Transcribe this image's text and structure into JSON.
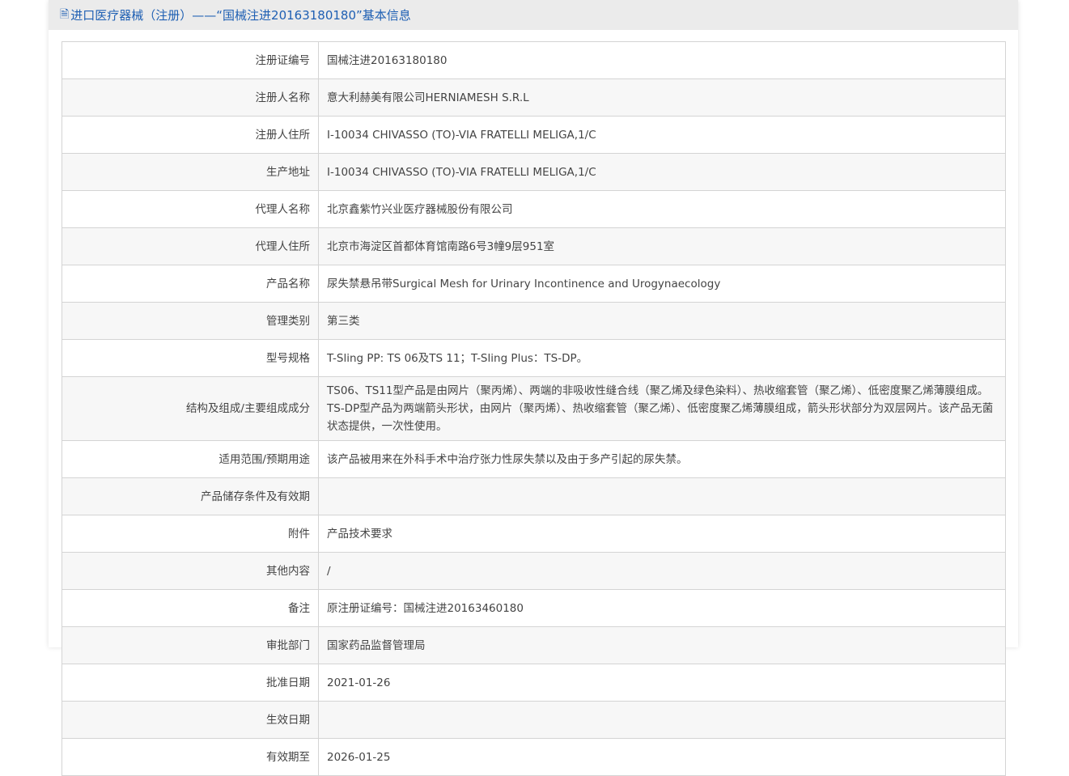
{
  "header": {
    "icon": "document-icon",
    "title": "进口医疗器械（注册）——“国械注进20163180180”基本信息"
  },
  "rows": [
    {
      "label": "注册证编号",
      "value": "国械注进20163180180"
    },
    {
      "label": "注册人名称",
      "value": "意大利赫美有限公司HERNIAMESH S.R.L"
    },
    {
      "label": "注册人住所",
      "value": "I-10034 CHIVASSO (TO)-VIA FRATELLI MELIGA,1/C"
    },
    {
      "label": "生产地址",
      "value": "I-10034 CHIVASSO (TO)-VIA FRATELLI MELIGA,1/C"
    },
    {
      "label": "代理人名称",
      "value": "北京鑫紫竹兴业医疗器械股份有限公司"
    },
    {
      "label": "代理人住所",
      "value": "北京市海淀区首都体育馆南路6号3幢9层951室"
    },
    {
      "label": "产品名称",
      "value": "尿失禁悬吊带Surgical Mesh for Urinary Incontinence and Urogynaecology"
    },
    {
      "label": "管理类别",
      "value": "第三类"
    },
    {
      "label": "型号规格",
      "value": "T-Sling PP: TS 06及TS 11；T-Sling Plus：TS-DP。"
    },
    {
      "label": "结构及组成/主要组成成分",
      "value": "TS06、TS11型产品是由网片（聚丙烯）、两端的非吸收性缝合线（聚乙烯及绿色染料）、热收缩套管（聚乙烯）、低密度聚乙烯薄膜组成。TS-DP型产品为两端箭头形状，由网片（聚丙烯）、热收缩套管（聚乙烯）、低密度聚乙烯薄膜组成，箭头形状部分为双层网片。该产品无菌状态提供，一次性使用。"
    },
    {
      "label": "适用范围/预期用途",
      "value": "该产品被用来在外科手术中治疗张力性尿失禁以及由于多产引起的尿失禁。"
    },
    {
      "label": "产品储存条件及有效期",
      "value": ""
    },
    {
      "label": "附件",
      "value": "产品技术要求"
    },
    {
      "label": "其他内容",
      "value": "/"
    },
    {
      "label": "备注",
      "value": "原注册证编号：国械注进20163460180"
    },
    {
      "label": "审批部门",
      "value": "国家药品监督管理局"
    },
    {
      "label": "批准日期",
      "value": "2021-01-26"
    },
    {
      "label": "生效日期",
      "value": ""
    },
    {
      "label": "有效期至",
      "value": "2026-01-25"
    }
  ]
}
